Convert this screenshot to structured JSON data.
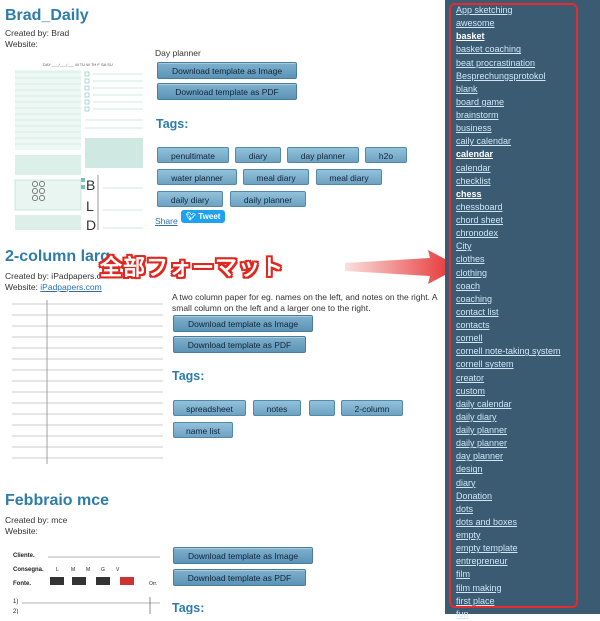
{
  "posts": [
    {
      "title": "Brad_Daily",
      "created": "Created by: Brad",
      "website_label": "Website:",
      "website": "",
      "description": "Day planner",
      "btn_image": "Download template as Image",
      "btn_pdf": "Download template as PDF",
      "tags_heading": "Tags:",
      "tags": [
        "penultimate",
        "diary",
        "day planner",
        "h2o",
        "water planner",
        "meal diary",
        "meal diary",
        "daily diary",
        "daily planner"
      ],
      "share": "Share",
      "tweet": "Tweet",
      "thumb_header": "DAY ___/___/___  M  TU  W  TH  F  SA  SU",
      "thumb_letters": [
        "B",
        "L",
        "D"
      ]
    },
    {
      "title": "2-column larg",
      "created": "Created by: iPadpapers.c",
      "website_label": "Website:",
      "website": "iPadpapers.com",
      "description": "A two column paper for eg. names on the left, and notes on the right. A small column on the left and a larger one to the right.",
      "btn_image": "Download template as Image",
      "btn_pdf": "Download template as PDF",
      "tags_heading": "Tags:",
      "tags": [
        "spreadsheet",
        "notes",
        "",
        "2-column",
        "name list"
      ]
    },
    {
      "title": "Febbraio mce",
      "created": "Created by: mce",
      "website_label": "Website:",
      "website": "",
      "btn_image": "Download template as Image",
      "btn_pdf": "Download template as PDF",
      "tags_heading": "Tags:",
      "thumb_labels": [
        "Cliente.",
        "Consegna.",
        "Fonte."
      ],
      "thumb_days": [
        "L",
        "M",
        "M",
        "G",
        "V"
      ],
      "thumb_rows": [
        "1)",
        "2)"
      ],
      "thumb_extra": "Orr."
    }
  ],
  "overlay_text": "全部フォーマット",
  "sidebar_tags": [
    {
      "label": "App sketching",
      "bold": false
    },
    {
      "label": "awesome",
      "bold": false
    },
    {
      "label": "basket",
      "bold": true
    },
    {
      "label": "basket coaching",
      "bold": false
    },
    {
      "label": "beat procrastination",
      "bold": false
    },
    {
      "label": "Besprechungsprotokol",
      "bold": false
    },
    {
      "label": "blank",
      "bold": false
    },
    {
      "label": "board game",
      "bold": false
    },
    {
      "label": "brainstorm",
      "bold": false
    },
    {
      "label": "business",
      "bold": false
    },
    {
      "label": "caily calendar",
      "bold": false
    },
    {
      "label": "calendar",
      "bold": true
    },
    {
      "label": "calendar",
      "bold": false
    },
    {
      "label": "checklist",
      "bold": false
    },
    {
      "label": "chess",
      "bold": true
    },
    {
      "label": "chessboard",
      "bold": false
    },
    {
      "label": "chord sheet",
      "bold": false
    },
    {
      "label": "chronodex",
      "bold": false
    },
    {
      "label": "City",
      "bold": false
    },
    {
      "label": "clothes",
      "bold": false
    },
    {
      "label": "clothing",
      "bold": false
    },
    {
      "label": "coach",
      "bold": false
    },
    {
      "label": "coaching",
      "bold": false
    },
    {
      "label": "contact list",
      "bold": false
    },
    {
      "label": "contacts",
      "bold": false
    },
    {
      "label": "cornell",
      "bold": false
    },
    {
      "label": "cornell note-taking system",
      "bold": false
    },
    {
      "label": "cornell system",
      "bold": false
    },
    {
      "label": "creator",
      "bold": false
    },
    {
      "label": "custom",
      "bold": false
    },
    {
      "label": "daily calendar",
      "bold": false
    },
    {
      "label": "daily diary",
      "bold": false
    },
    {
      "label": "daily planner",
      "bold": false
    },
    {
      "label": "daily planner",
      "bold": false
    },
    {
      "label": "day planner",
      "bold": false
    },
    {
      "label": "design",
      "bold": false
    },
    {
      "label": "diary",
      "bold": false
    },
    {
      "label": "Donation",
      "bold": false
    },
    {
      "label": "dots",
      "bold": false
    },
    {
      "label": "dots and boxes",
      "bold": false
    },
    {
      "label": "empty",
      "bold": false
    },
    {
      "label": "empty template",
      "bold": false
    },
    {
      "label": "entrepreneur",
      "bold": false
    },
    {
      "label": "film",
      "bold": false
    },
    {
      "label": "film making",
      "bold": false
    },
    {
      "label": "first place",
      "bold": false
    },
    {
      "label": "fun",
      "bold": false
    }
  ],
  "colors": {
    "sidebar_bg": "#3b5b72",
    "accent": "#2e7cab",
    "annotation_red": "#e52b2b"
  }
}
